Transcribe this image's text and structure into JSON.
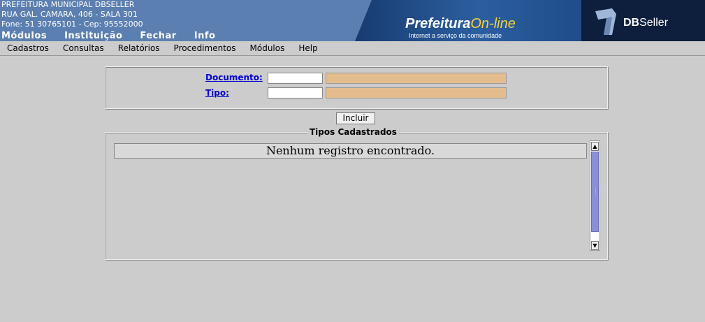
{
  "header": {
    "org_line1": "PREFEITURA MUNICIPAL DBSELLER",
    "org_line2": "RUA GAL. CAMARA, 406 - SALA 301",
    "org_line3": "Fone: 51 30765101  -  Cep: 95552000",
    "top_menu": [
      "Módulos",
      "Instituição",
      "Fechar",
      "Info"
    ],
    "banner_title_a": "Prefeitura",
    "banner_title_b": "On-line",
    "banner_sub": "Internet a serviço da comunidade",
    "vendor_bold": "DB",
    "vendor_rest": "Seller"
  },
  "menubar": [
    "Cadastros",
    "Consultas",
    "Relatórios",
    "Procedimentos",
    "Módulos",
    "Help"
  ],
  "form": {
    "documento_label": "Documento:",
    "documento_value": "",
    "documento_desc": "",
    "tipo_label": "Tipo:",
    "tipo_value": "",
    "tipo_desc": ""
  },
  "incluir_label": "Incluir",
  "list": {
    "legend": "Tipos Cadastrados",
    "empty_message": "Nenhum registro encontrado."
  },
  "colors": {
    "header_bg": "#5b7fb0",
    "readonly_field": "#e4bd8f",
    "scroll_thumb": "#8b8fd6"
  }
}
